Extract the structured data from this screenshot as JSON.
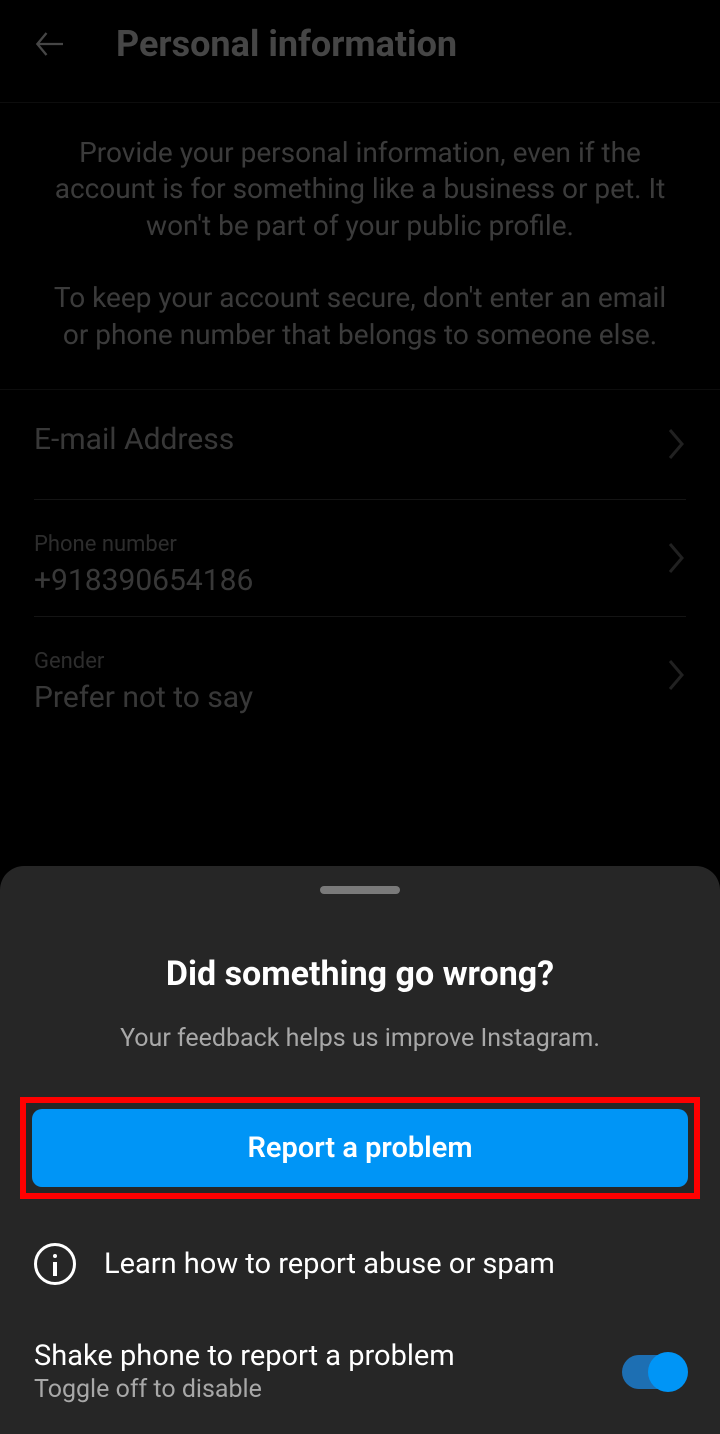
{
  "header": {
    "title": "Personal information"
  },
  "info": {
    "paragraph1": "Provide your personal information, even if the account is for something like a business or pet. It won't be part of your public profile.",
    "paragraph2": "To keep your account secure, don't enter an email or phone number that belongs to someone else."
  },
  "fields": {
    "email": {
      "label": "E-mail Address",
      "value": ""
    },
    "phone": {
      "label": "Phone number",
      "value": "+918390654186"
    },
    "gender": {
      "label": "Gender",
      "value": "Prefer not to say"
    }
  },
  "sheet": {
    "title": "Did something go wrong?",
    "subtitle": "Your feedback helps us improve Instagram.",
    "report_button": "Report a problem",
    "learn_link": "Learn how to report abuse or spam",
    "shake": {
      "title": "Shake phone to report a problem",
      "subtitle": "Toggle off to disable"
    }
  }
}
